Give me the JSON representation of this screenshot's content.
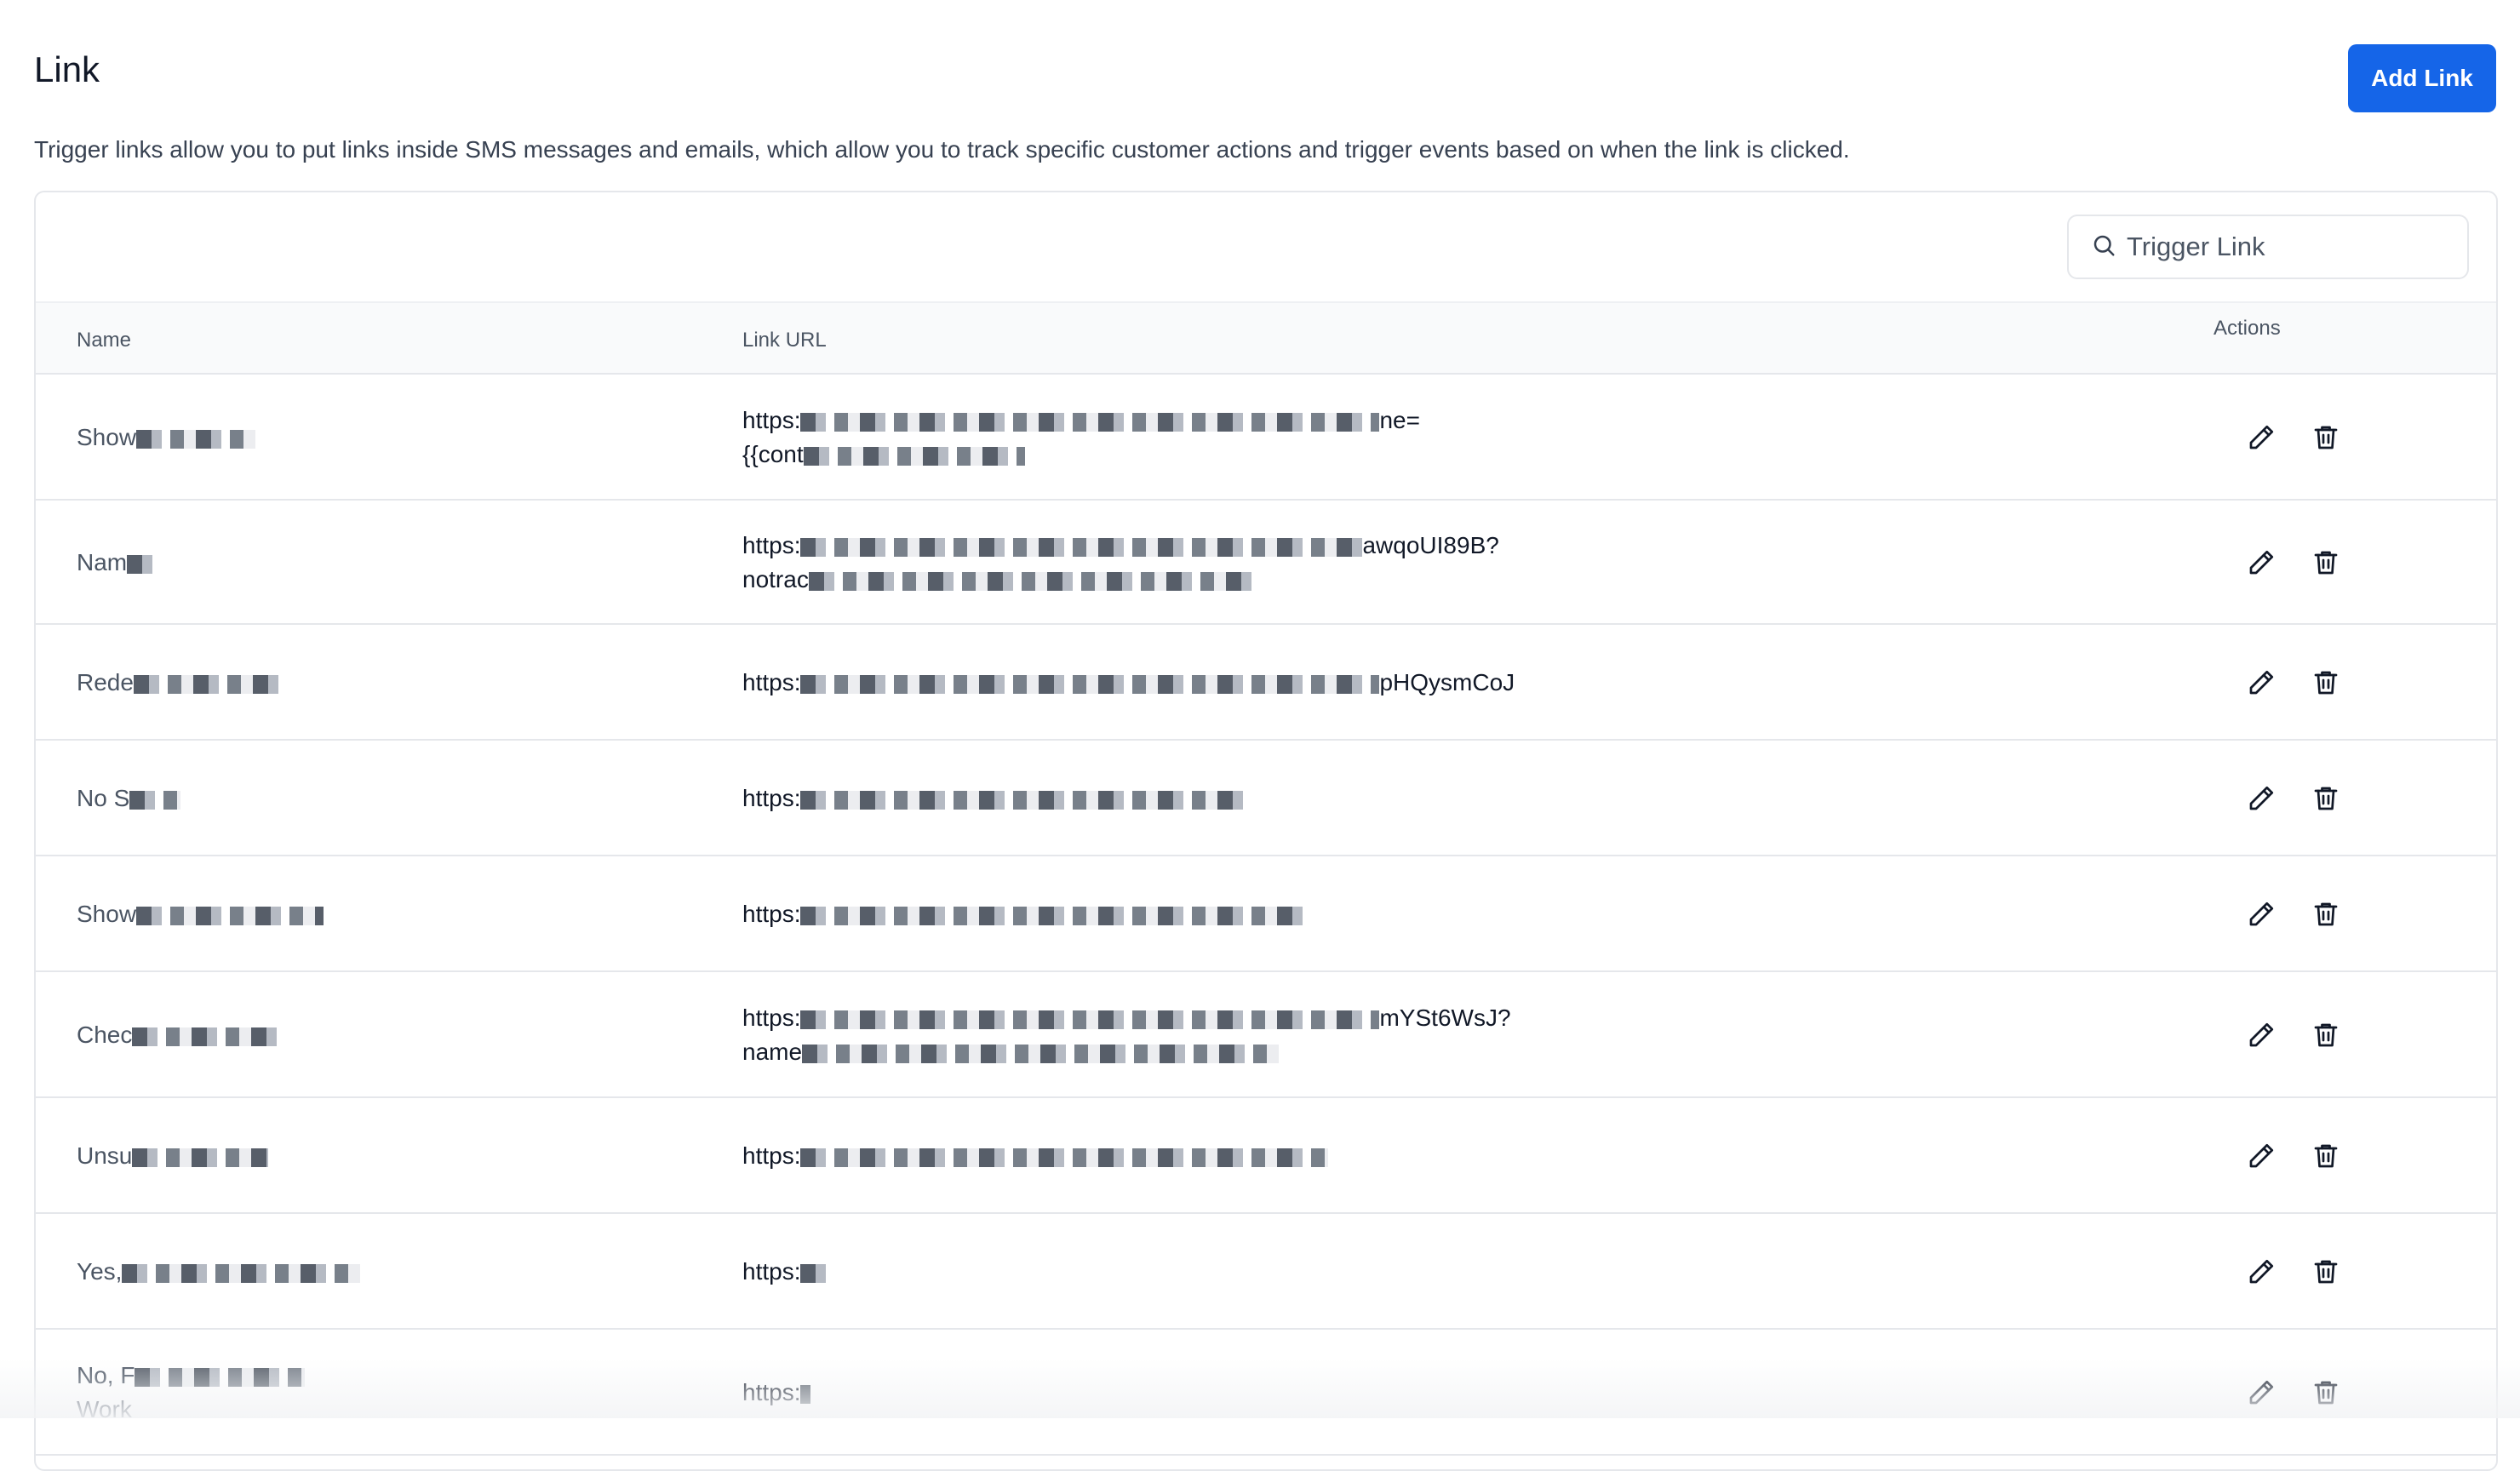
{
  "page": {
    "title": "Link",
    "description": "Trigger links allow you to put links inside SMS messages and emails, which allow you to track specific customer actions and trigger events based on when the link is clicked.",
    "add_button_label": "Add Link"
  },
  "search": {
    "placeholder": "Trigger Link",
    "icon": "search-icon"
  },
  "table": {
    "columns": {
      "name": "Name",
      "url": "Link URL",
      "actions": "Actions"
    },
    "action_icons": [
      "pencil-icon",
      "trash-icon"
    ],
    "rows": [
      {
        "name": "Show",
        "url_line1": "https:",
        "url_end1": "ne=",
        "url_line2": "{{cont",
        "url_end2": ""
      },
      {
        "name": "Nam",
        "url_line1": "https:",
        "url_end1": "awqoUI89B?",
        "url_line2": "notrac",
        "url_end2": ""
      },
      {
        "name": "Rede",
        "url_line1": "https:",
        "url_end1": "pHQysmCoJ",
        "url_line2": "",
        "url_end2": ""
      },
      {
        "name": "No S",
        "url_line1": "https:",
        "url_end1": "",
        "url_line2": "",
        "url_end2": ""
      },
      {
        "name": "Show",
        "url_line1": "https:",
        "url_end1": "",
        "url_line2": "",
        "url_end2": ""
      },
      {
        "name": "Chec",
        "url_line1": "https:",
        "url_end1": "mYSt6WsJ?",
        "url_line2": "name",
        "url_end2": ""
      },
      {
        "name": "Unsu",
        "url_line1": "https:",
        "url_end1": "",
        "url_line2": "",
        "url_end2": ""
      },
      {
        "name": "Yes,",
        "url_line1": "https:",
        "url_end1": "",
        "url_line2": "",
        "url_end2": ""
      },
      {
        "name": "No, F",
        "name_line2": "Work",
        "url_line1": "https:",
        "url_end1": "",
        "url_line2": "",
        "url_end2": ""
      }
    ]
  }
}
